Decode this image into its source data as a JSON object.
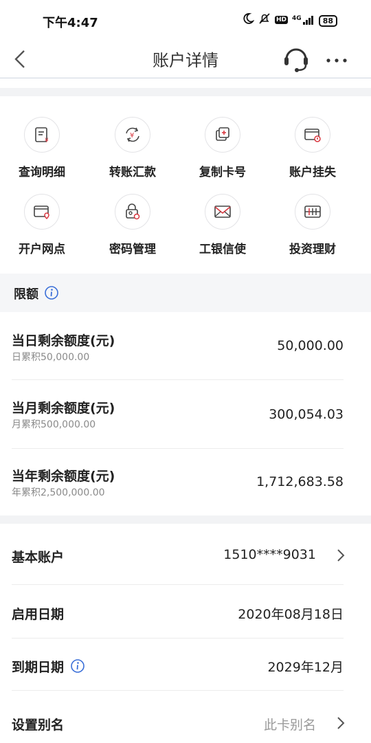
{
  "status": {
    "time": "下午4:47",
    "network": "4G",
    "battery": "88"
  },
  "nav": {
    "title": "账户详情"
  },
  "actions": [
    {
      "label": "查询明细",
      "icon": "statement-icon"
    },
    {
      "label": "转账汇款",
      "icon": "transfer-icon"
    },
    {
      "label": "复制卡号",
      "icon": "copy-card-icon"
    },
    {
      "label": "账户挂失",
      "icon": "report-loss-icon"
    },
    {
      "label": "开户网点",
      "icon": "branch-location-icon"
    },
    {
      "label": "密码管理",
      "icon": "password-icon"
    },
    {
      "label": "工银信使",
      "icon": "message-envelope-icon"
    },
    {
      "label": "投资理财",
      "icon": "invest-icon"
    }
  ],
  "limits": {
    "title": "限额",
    "daily": {
      "label": "当日剩余额度(元)",
      "sub": "日累积50,000.00",
      "value": "50,000.00"
    },
    "monthly": {
      "label": "当月剩余额度(元)",
      "sub": "月累积500,000.00",
      "value": "300,054.03"
    },
    "yearly": {
      "label": "当年剩余额度(元)",
      "sub": "年累积2,500,000.00",
      "value": "1,712,683.58"
    }
  },
  "account": {
    "basic": {
      "label": "基本账户",
      "value": "1510****9031"
    },
    "start": {
      "label": "启用日期",
      "value": "2020年08月18日"
    },
    "expire": {
      "label": "到期日期",
      "value": "2029年12月"
    },
    "alias": {
      "label": "设置别名",
      "placeholder": "此卡别名"
    }
  },
  "colors": {
    "accent_red": "#d9363e",
    "info_blue": "#3a6fd8",
    "band_gray": "#f2f3f5"
  }
}
